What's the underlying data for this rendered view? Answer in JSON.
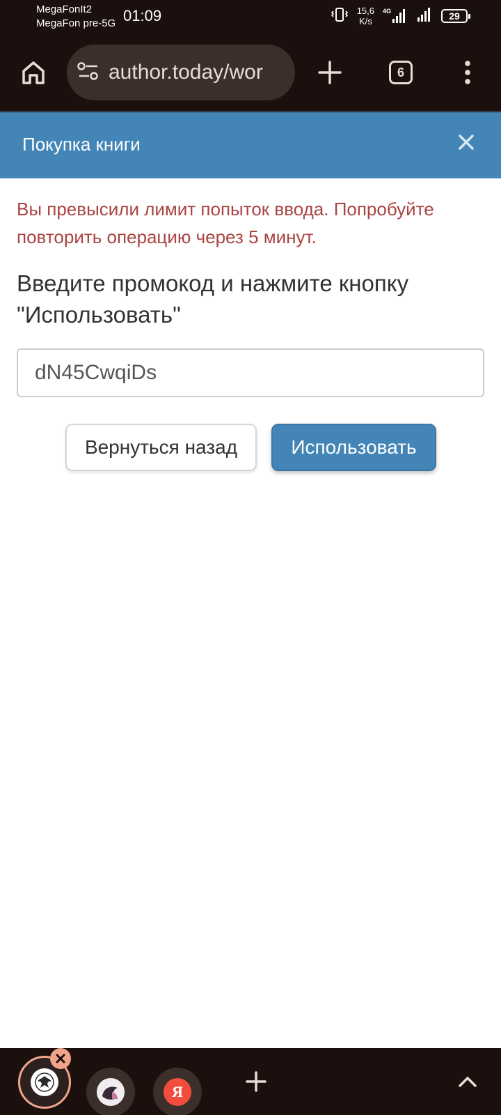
{
  "status_bar": {
    "carrier1": "MegaFonIt2",
    "carrier2": "MegaFon pre-5G",
    "time": "01:09",
    "net_speed_value": "15,6",
    "net_speed_unit": "K/s",
    "network_type": "4G",
    "battery": "29"
  },
  "browser": {
    "url": "author.today/wor",
    "tab_count": "6"
  },
  "modal": {
    "title": "Покупка книги",
    "error": "Вы превысили лимит попыток ввода. Попробуйте повторить операцию через 5 минут.",
    "prompt": "Введите промокод и нажмите кнопку \"Использовать\"",
    "promo_value": "dN45CwqiDs",
    "back_label": "Вернуться назад",
    "use_label": "Использовать"
  },
  "tab_strip": {
    "yandex_letter": "Я"
  },
  "colors": {
    "header_bg": "#4385b6",
    "error_text": "#a94442",
    "browser_chrome": "#1b100d",
    "accent_tab": "#f0a58a"
  }
}
